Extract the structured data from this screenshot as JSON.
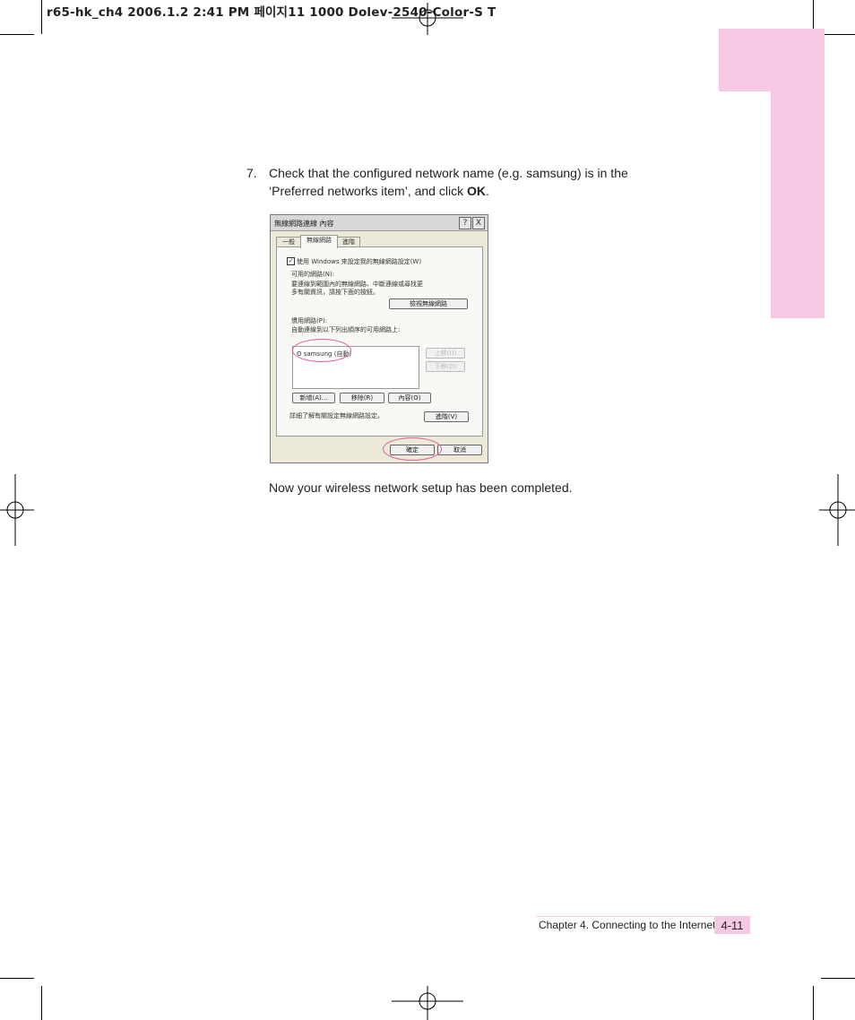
{
  "slug": "r65-hk_ch4  2006.1.2 2:41 PM  페이지11   1000 Dolev-2540-Color-S  T",
  "step": {
    "number": "7.",
    "text_before": "Check that the configured network name (e.g. samsung) is in the ‘Preferred networks item’, and click ",
    "text_bold": "OK",
    "text_after": "."
  },
  "completion_text": "Now your wireless network setup has been completed.",
  "footer": {
    "chapter": "Chapter 4. Connecting to the Internet",
    "page_number": "4-11"
  },
  "dialog": {
    "title": "無線網路連線 內容",
    "help_button": "?",
    "close_button": "X",
    "tabs": [
      "一般",
      "無線網路",
      "進階"
    ],
    "use_windows_checkbox": "使用 Windows 來設定我的無線網路設定(W)",
    "available_networks_label": "可用的網路(N):",
    "available_networks_desc_line1": "要連線到範圍內的無線網路、中斷連線或尋找更",
    "available_networks_desc_line2": "多有關資訊，請按下面的按鈕。",
    "view_networks_button": "檢視無線網路",
    "preferred_networks_label": "慣用網路(P):",
    "preferred_networks_desc": "自動連線到以下列出順序的可用網路上:",
    "preferred_network_item": "samsung (自動)",
    "move_up_button": "上移(U)",
    "move_down_button": "下移(D)",
    "add_button": "新增(A)...",
    "remove_button": "移除(R)",
    "properties_button": "內容(O)",
    "learn_more_text": "詳細了解有關設定無線網路設定。",
    "advanced_button": "進階(V)",
    "ok_button": "確定",
    "cancel_button": "取消"
  },
  "colors": {
    "accent_pink": "#f6c8e4",
    "highlight_circle": "#e05aa0"
  }
}
